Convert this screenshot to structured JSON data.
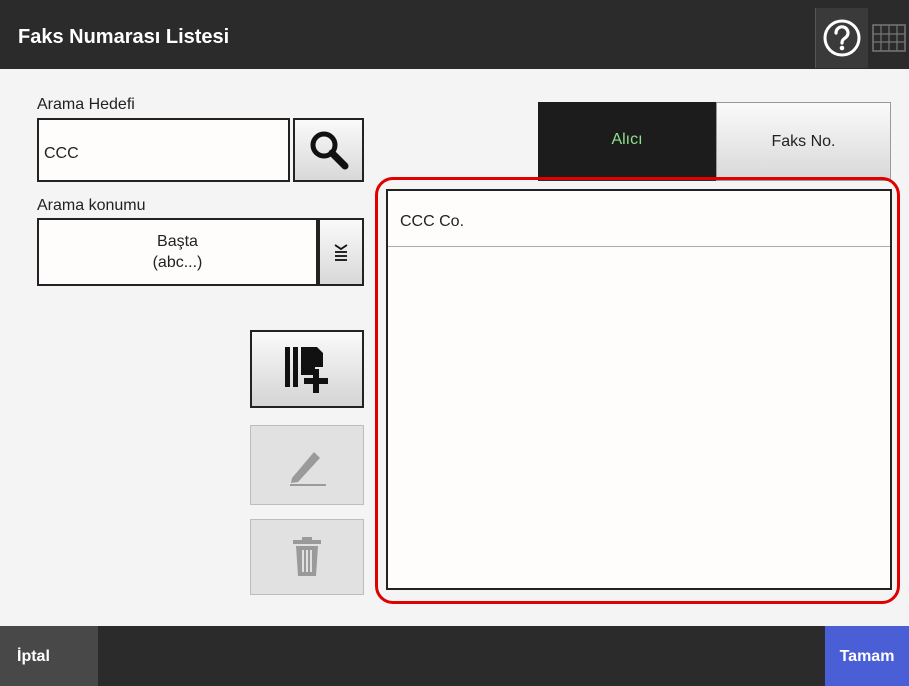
{
  "window": {
    "title": "Faks Numarası Listesi"
  },
  "header": {
    "help_icon": "question-circle-icon",
    "keyboard_icon": "keyboard-icon"
  },
  "search": {
    "label": "Arama Hedefi",
    "value": "CCC",
    "button_icon": "search-icon"
  },
  "location": {
    "label": "Arama konumu",
    "value_line1": "Başta",
    "value_line2": "(abc...)",
    "dropdown_icon": "dropdown-list-icon"
  },
  "actions": {
    "add_icon": "add-entry-icon",
    "edit_icon": "pencil-icon",
    "delete_icon": "trash-icon",
    "edit_enabled": false,
    "delete_enabled": false
  },
  "tabs": [
    {
      "label": "Alıcı",
      "selected": true
    },
    {
      "label": "Faks No.",
      "selected": false
    }
  ],
  "list": {
    "items": [
      "CCC Co."
    ]
  },
  "footer": {
    "cancel_label": "İptal",
    "ok_label": "Tamam"
  },
  "colors": {
    "highlight": "#e00000",
    "ok_button": "#4a5fd6",
    "selected_tab_text": "#8ee08e",
    "titlebar": "#2b2b2b"
  }
}
